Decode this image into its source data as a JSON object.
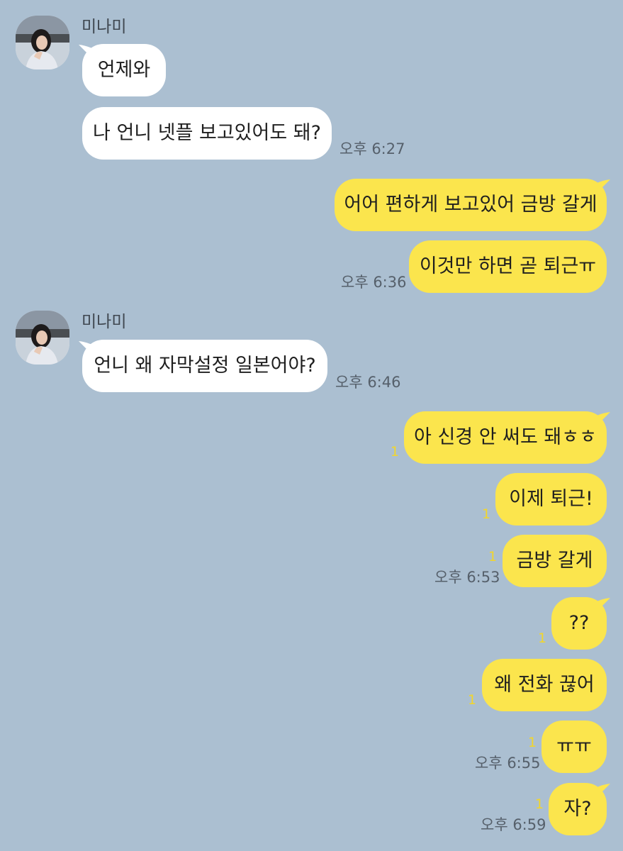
{
  "colors": {
    "background": "#abbfd1",
    "incoming_bubble": "#ffffff",
    "outgoing_bubble": "#fbe54d",
    "unread_count": "#f2d62b",
    "timestamp": "#56606b"
  },
  "chat": {
    "groups": [
      {
        "sender": "미나미",
        "messages": [
          {
            "text": "언제와"
          },
          {
            "text": "나 언니 넷플 보고있어도 돼?",
            "time": "오후 6:27"
          }
        ]
      },
      {
        "sender": "me",
        "messages": [
          {
            "text": "어어 편하게 보고있어 금방 갈게"
          },
          {
            "text": "이것만 하면 곧 퇴근ㅠ",
            "time": "오후 6:36"
          }
        ]
      },
      {
        "sender": "미나미",
        "messages": [
          {
            "text": "언니 왜 자막설정 일본어야?",
            "time": "오후 6:46"
          }
        ]
      },
      {
        "sender": "me",
        "messages": [
          {
            "text": "아 신경 안 써도 돼ㅎㅎ",
            "unread": "1"
          },
          {
            "text": "이제 퇴근!",
            "unread": "1"
          },
          {
            "text": "금방 갈게",
            "unread": "1",
            "time": "오후 6:53"
          }
        ]
      },
      {
        "sender": "me",
        "messages": [
          {
            "text": "??",
            "unread": "1"
          },
          {
            "text": "왜 전화 끊어",
            "unread": "1"
          },
          {
            "text": "ㅠㅠ",
            "unread": "1",
            "time": "오후 6:55"
          }
        ]
      },
      {
        "sender": "me",
        "messages": [
          {
            "text": "자?",
            "unread": "1",
            "time": "오후 6:59"
          }
        ]
      }
    ]
  }
}
